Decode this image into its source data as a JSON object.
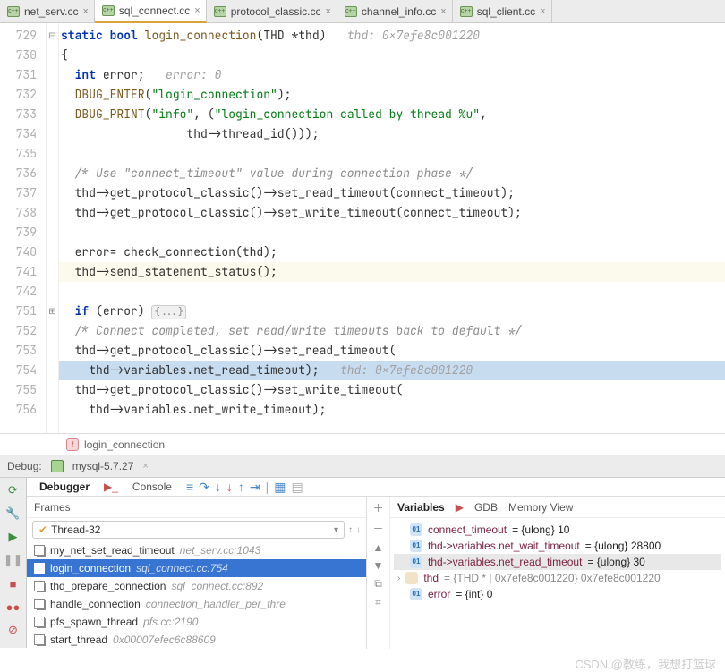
{
  "tabs": [
    {
      "label": "net_serv.cc",
      "active": false
    },
    {
      "label": "sql_connect.cc",
      "active": true
    },
    {
      "label": "protocol_classic.cc",
      "active": false
    },
    {
      "label": "channel_info.cc",
      "active": false
    },
    {
      "label": "sql_client.cc",
      "active": false
    }
  ],
  "gutter_lines": [
    "729",
    "730",
    "731",
    "732",
    "733",
    "734",
    "735",
    "736",
    "737",
    "738",
    "739",
    "740",
    "741",
    "742",
    "751",
    "752",
    "753",
    "754",
    "755",
    "756"
  ],
  "fold_markers": {
    "0": "⊟",
    "14": "⊞"
  },
  "code": {
    "l0_kw_static": "static",
    "l0_kw_bool": "bool",
    "l0_fn": "login_connection",
    "l0_sig": "(THD *thd)",
    "l0_hint": "   thd: 0x7efe8c001220",
    "l1": "{",
    "l2_kw": "int",
    "l2_rest": " error;",
    "l2_hint": "   error: 0",
    "l3_fn": "DBUG_ENTER",
    "l3_open": "(",
    "l3_str": "\"login_connection\"",
    "l3_close": ");",
    "l4_fn": "DBUG_PRINT",
    "l4_open": "(",
    "l4_str1": "\"info\"",
    "l4_mid": ", (",
    "l4_str2": "\"login_connection called by thread %u\"",
    "l4_end": ",",
    "l5": "                  thd->thread_id()));",
    "l6": "",
    "l7": "  /* Use \"connect_timeout\" value during connection phase */",
    "l8": "  thd->get_protocol_classic()->set_read_timeout(connect_timeout);",
    "l9": "  thd->get_protocol_classic()->set_write_timeout(connect_timeout);",
    "l10": "",
    "l11": "  error= check_connection(thd);",
    "l12": "  thd->send_statement_status();",
    "l13": "",
    "l14_kw": "if",
    "l14_rest": " (error) ",
    "l14_fold": "{...}",
    "l15": "  /* Connect completed, set read/write timeouts back to default */",
    "l16": "  thd->get_protocol_classic()->set_read_timeout(",
    "l17_code": "    thd->variables.net_read_timeout);",
    "l17_hint": "   thd: 0x7efe8c001220",
    "l18": "  thd->get_protocol_classic()->set_write_timeout(",
    "l19": "    thd->variables.net_write_timeout);"
  },
  "breadcrumb": {
    "icon": "f",
    "label": "login_connection"
  },
  "debug": {
    "label": "Debug:",
    "config": "mysql-5.7.27",
    "tabs": {
      "debugger": "Debugger",
      "console": "Console"
    },
    "frames_label": "Frames",
    "thread": "Thread-32",
    "frames": [
      {
        "name": "my_net_set_read_timeout",
        "loc": "net_serv.cc:1043"
      },
      {
        "name": "login_connection",
        "loc": "sql_connect.cc:754",
        "selected": true
      },
      {
        "name": "thd_prepare_connection",
        "loc": "sql_connect.cc:892"
      },
      {
        "name": "handle_connection",
        "loc": "connection_handler_per_thre"
      },
      {
        "name": "pfs_spawn_thread",
        "loc": "pfs.cc:2190"
      },
      {
        "name": "start_thread",
        "loc": "0x00007efec6c88609"
      }
    ],
    "var_tabs": {
      "variables": "Variables",
      "gdb": "GDB",
      "memory": "Memory View"
    },
    "vars": [
      {
        "icon": "01",
        "name": "connect_timeout",
        "val": " = {ulong} 10"
      },
      {
        "icon": "01",
        "name": "thd->variables.net_wait_timeout",
        "val": " = {ulong} 28800"
      },
      {
        "icon": "01",
        "name": "thd->variables.net_read_timeout",
        "val": " = {ulong} 30",
        "selected": true
      },
      {
        "icon": "",
        "name": "thd",
        "val": " = {THD * | 0x7efe8c001220} 0x7efe8c001220",
        "expandable": true
      },
      {
        "icon": "01",
        "name": "error",
        "val": " = {int} 0"
      }
    ]
  },
  "watermark": "CSDN @教练，我想打篮球"
}
